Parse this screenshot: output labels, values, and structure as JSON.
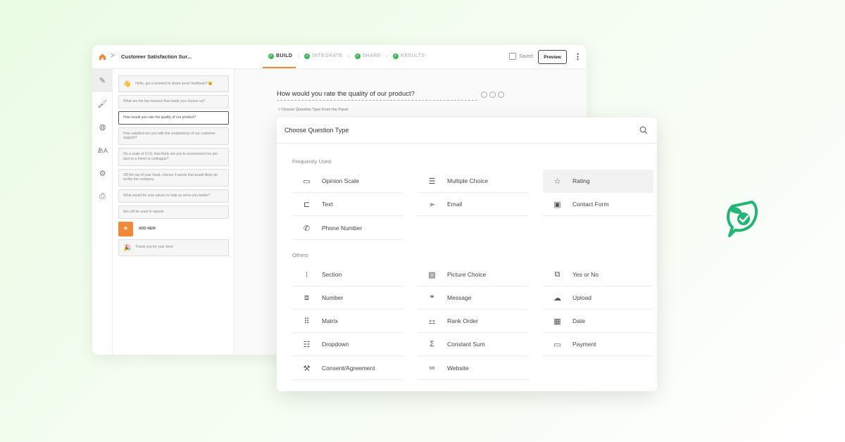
{
  "header": {
    "breadcrumb_sep": ">",
    "doc_title": "Customer Satisfaction Sur...",
    "steps": [
      {
        "label": "BUILD",
        "active": true
      },
      {
        "label": "INTEGRATE",
        "active": false
      },
      {
        "label": "SHARE",
        "active": false
      },
      {
        "label": "RESULTS",
        "active": false
      }
    ],
    "saved_label": "Saved",
    "preview_label": "Preview",
    "kebab": "⋮"
  },
  "question_list": {
    "welcome": "Hello, got a moment to share some feedback? 😀",
    "items": [
      "What are the top reasons that made you choose us?",
      "How would you rate the quality of our product?",
      "How satisfied are you with the competency of our customer support?",
      "On a scale of 0-10, how likely are you to recommend our pro duct to a friend or colleague?",
      "Off the top of your head, choose 3 words that would likely de scribe the company.",
      "What would be your advice to help us serve you better?",
      "this will be used in reports"
    ],
    "add_new": "ADD NEW",
    "thank_you": "Thank you for your time!"
  },
  "main": {
    "question": "How would you rate the quality of our product?",
    "hint": "Choose Question Type From the Panel"
  },
  "question_types": {
    "title": "Choose Question Type",
    "frequently_used_label": "Frequently Used",
    "others_label": "Others",
    "frequently_used": [
      {
        "label": "Opinion Scale",
        "icon": "opinion-scale-icon"
      },
      {
        "label": "Multiple Choice",
        "icon": "multiple-choice-icon"
      },
      {
        "label": "Rating",
        "icon": "star-icon"
      },
      {
        "label": "Text",
        "icon": "text-icon"
      },
      {
        "label": "Email",
        "icon": "paper-plane-icon"
      },
      {
        "label": "Contact Form",
        "icon": "contact-card-icon"
      },
      {
        "label": "Phone Number",
        "icon": "phone-icon"
      }
    ],
    "others": [
      {
        "label": "Section",
        "icon": "section-icon"
      },
      {
        "label": "Picture Choice",
        "icon": "picture-icon"
      },
      {
        "label": "Yes or No",
        "icon": "yes-no-icon"
      },
      {
        "label": "Number",
        "icon": "number-icon"
      },
      {
        "label": "Message",
        "icon": "quote-icon"
      },
      {
        "label": "Upload",
        "icon": "cloud-upload-icon"
      },
      {
        "label": "Matrix",
        "icon": "matrix-icon"
      },
      {
        "label": "Rank Order",
        "icon": "rank-order-icon"
      },
      {
        "label": "Date",
        "icon": "calendar-icon"
      },
      {
        "label": "Dropdown",
        "icon": "dropdown-icon"
      },
      {
        "label": "Constant Sum",
        "icon": "sigma-icon"
      },
      {
        "label": "Payment",
        "icon": "card-icon"
      },
      {
        "label": "Consent/Agreement",
        "icon": "gavel-icon"
      },
      {
        "label": "Website",
        "icon": "link-icon"
      }
    ]
  },
  "colors": {
    "accent_orange": "#f08a3a",
    "step_green": "#3cb95a",
    "brand_green": "#22b573"
  }
}
